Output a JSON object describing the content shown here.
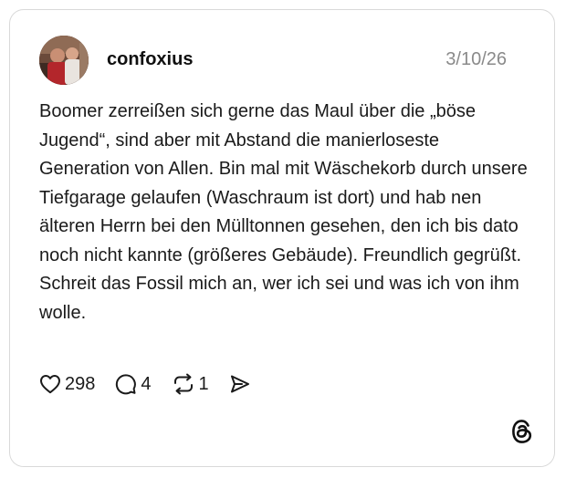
{
  "post": {
    "username": "confoxius",
    "date": "3/10/26",
    "text": "Boomer zerreißen sich gerne das Maul über die „böse Jugend“, sind aber mit Abstand die manierloseste Generation von Allen. Bin mal mit Wäschekorb durch unsere Tiefgarage gelaufen (Waschraum ist dort) und hab nen älteren Herrn bei den Mülltonnen gesehen, den ich bis dato noch nicht kannte (größeres Gebäude). Freundlich gegrüßt. Schreit das Fossil mich an, wer ich sei und was ich von ihm wolle."
  },
  "actions": {
    "likes": "298",
    "replies": "4",
    "reposts": "1"
  },
  "icons": {
    "like": "heart-icon",
    "reply": "comment-bubble-icon",
    "repost": "repost-arrows-icon",
    "share": "send-icon",
    "brand": "threads-logo-icon"
  },
  "colors": {
    "text": "#101010",
    "muted": "#8a8a8a",
    "border": "#d9d9d9"
  }
}
